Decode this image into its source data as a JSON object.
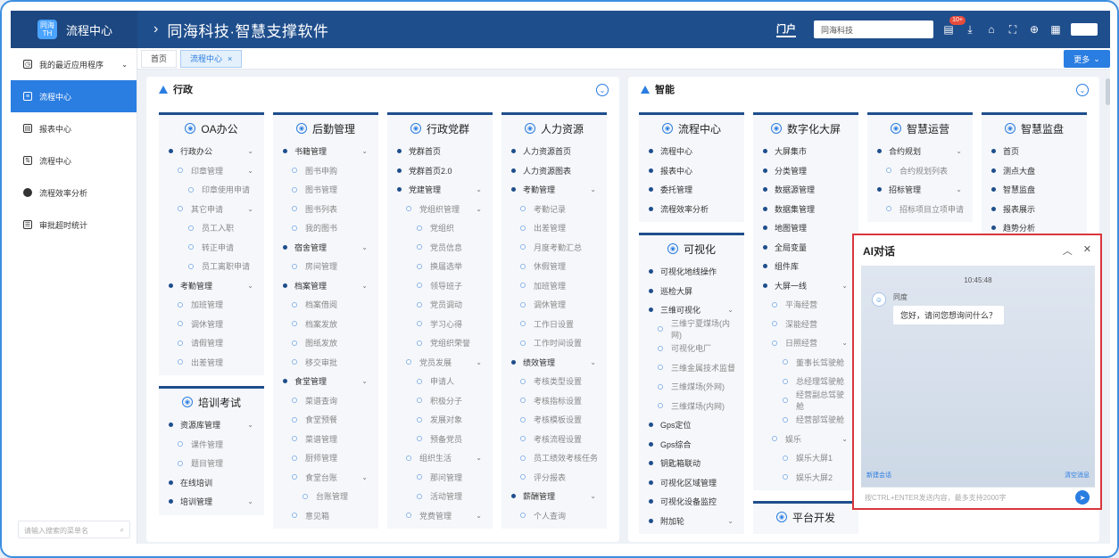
{
  "header": {
    "app_title": "流程中心",
    "logo_text": "同海 TH",
    "system_title": "同海科技·智慧支撑软件",
    "brand_icon": "门户",
    "search_value": "同海科技",
    "badge": "10+"
  },
  "sidebar": {
    "items": [
      {
        "label": "我的最近应用程序",
        "icon": "clock-icon"
      },
      {
        "label": "流程中心",
        "icon": "list-icon"
      },
      {
        "label": "报表中心",
        "icon": "report-icon"
      },
      {
        "label": "流程中心",
        "icon": "flow-icon"
      },
      {
        "label": "流程效率分析",
        "icon": "pie-icon"
      },
      {
        "label": "审批超时统计",
        "icon": "db-icon"
      }
    ],
    "search_placeholder": "请输入搜索的菜单名"
  },
  "tabs": {
    "items": [
      "首页",
      "流程中心"
    ],
    "more": "更多"
  },
  "panels": {
    "left_title": "行政",
    "right_title": "智能"
  },
  "left_cols": [
    [
      {
        "title": "OA办公",
        "items": [
          [
            "l1",
            "行政办公",
            1
          ],
          [
            "l2",
            "印章管理",
            1
          ],
          [
            "l3",
            "印章使用申请",
            0
          ],
          [
            "l2",
            "其它申请",
            1
          ],
          [
            "l3",
            "员工入职",
            0
          ],
          [
            "l3",
            "转正申请",
            0
          ],
          [
            "l3",
            "员工离职申请",
            0
          ],
          [
            "l1",
            "考勤管理",
            1
          ],
          [
            "l2",
            "加班管理",
            0
          ],
          [
            "l2",
            "调休管理",
            0
          ],
          [
            "l2",
            "请假管理",
            0
          ],
          [
            "l2",
            "出差管理",
            0
          ]
        ]
      },
      {
        "title": "培训考试",
        "items": [
          [
            "l1",
            "资源库管理",
            1
          ],
          [
            "l2",
            "课件管理",
            0
          ],
          [
            "l2",
            "题目管理",
            0
          ],
          [
            "l1",
            "在线培训",
            0
          ],
          [
            "l1",
            "培训管理",
            1
          ]
        ]
      }
    ],
    [
      {
        "title": "后勤管理",
        "items": [
          [
            "l1",
            "书籍管理",
            1
          ],
          [
            "l2",
            "图书申购",
            0
          ],
          [
            "l2",
            "图书管理",
            0
          ],
          [
            "l2",
            "图书列表",
            0
          ],
          [
            "l2",
            "我的图书",
            0
          ],
          [
            "l1",
            "宿舍管理",
            1
          ],
          [
            "l2",
            "房间管理",
            0
          ],
          [
            "l1",
            "档案管理",
            1
          ],
          [
            "l2",
            "档案借阅",
            0
          ],
          [
            "l2",
            "档案发放",
            0
          ],
          [
            "l2",
            "图纸发放",
            0
          ],
          [
            "l2",
            "移交审批",
            0
          ],
          [
            "l1",
            "食堂管理",
            1
          ],
          [
            "l2",
            "菜谱查询",
            0
          ],
          [
            "l2",
            "食堂预餐",
            0
          ],
          [
            "l2",
            "菜谱管理",
            0
          ],
          [
            "l2",
            "厨师管理",
            0
          ],
          [
            "l2",
            "食堂台账",
            1
          ],
          [
            "l3",
            "台账管理",
            0
          ],
          [
            "l2",
            "意见箱",
            0
          ]
        ]
      }
    ],
    [
      {
        "title": "行政党群",
        "items": [
          [
            "l1",
            "党群首页",
            0
          ],
          [
            "l1",
            "党群首页2.0",
            0
          ],
          [
            "l1",
            "党建管理",
            1
          ],
          [
            "l2",
            "党组织管理",
            1
          ],
          [
            "l3",
            "党组织",
            0
          ],
          [
            "l3",
            "党员信息",
            0
          ],
          [
            "l3",
            "换届选举",
            0
          ],
          [
            "l3",
            "领导班子",
            0
          ],
          [
            "l3",
            "党员调动",
            0
          ],
          [
            "l3",
            "学习心得",
            0
          ],
          [
            "l3",
            "党组织荣誉",
            0
          ],
          [
            "l2",
            "党员发展",
            1
          ],
          [
            "l3",
            "申请人",
            0
          ],
          [
            "l3",
            "积极分子",
            0
          ],
          [
            "l3",
            "发展对象",
            0
          ],
          [
            "l3",
            "预备党员",
            0
          ],
          [
            "l2",
            "组织生活",
            1
          ],
          [
            "l3",
            "那问管理",
            0
          ],
          [
            "l3",
            "活动管理",
            0
          ],
          [
            "l2",
            "党费管理",
            1
          ]
        ]
      }
    ],
    [
      {
        "title": "人力资源",
        "items": [
          [
            "l1",
            "人力资源首页",
            0
          ],
          [
            "l1",
            "人力资源图表",
            0
          ],
          [
            "l1",
            "考勤管理",
            1
          ],
          [
            "l2",
            "考勤记录",
            0
          ],
          [
            "l2",
            "出差管理",
            0
          ],
          [
            "l2",
            "月度考勤汇总",
            0
          ],
          [
            "l2",
            "休假管理",
            0
          ],
          [
            "l2",
            "加班管理",
            0
          ],
          [
            "l2",
            "调休管理",
            0
          ],
          [
            "l2",
            "工作日设置",
            0
          ],
          [
            "l2",
            "工作时间设置",
            0
          ],
          [
            "l1",
            "绩效管理",
            1
          ],
          [
            "l2",
            "考核类型设置",
            0
          ],
          [
            "l2",
            "考核指标设置",
            0
          ],
          [
            "l2",
            "考核模板设置",
            0
          ],
          [
            "l2",
            "考核流程设置",
            0
          ],
          [
            "l2",
            "员工绩效考核任务",
            0
          ],
          [
            "l2",
            "评分报表",
            0
          ],
          [
            "l1",
            "薪酬管理",
            1
          ],
          [
            "l2",
            "个人查询",
            0
          ]
        ]
      }
    ]
  ],
  "right_cols": [
    [
      {
        "title": "流程中心",
        "items": [
          [
            "l1",
            "流程中心",
            0
          ],
          [
            "l1",
            "报表中心",
            0
          ],
          [
            "l1",
            "委托管理",
            0
          ],
          [
            "l1",
            "流程效率分析",
            0
          ]
        ]
      },
      {
        "title": "可视化",
        "items": [
          [
            "l1",
            "可视化地线操作",
            0
          ],
          [
            "l1",
            "巡检大屏",
            0
          ],
          [
            "l1",
            "三维可视化",
            1
          ],
          [
            "l2",
            "三维宁夏煤场(内网)",
            0
          ],
          [
            "l2",
            "可视化电厂",
            0
          ],
          [
            "l2",
            "三维金属技术监督",
            0
          ],
          [
            "l2",
            "三维煤场(外网)",
            0
          ],
          [
            "l2",
            "三维煤场(内网)",
            0
          ],
          [
            "l1",
            "Gps定位",
            0
          ],
          [
            "l1",
            "Gps综合",
            0
          ],
          [
            "l1",
            "钥匙箱联动",
            0
          ],
          [
            "l1",
            "可视化区域管理",
            0
          ],
          [
            "l1",
            "可视化设备监控",
            0
          ],
          [
            "l1",
            "附加轮",
            1
          ]
        ]
      }
    ],
    [
      {
        "title": "数字化大屏",
        "items": [
          [
            "l1",
            "大屏集市",
            0
          ],
          [
            "l1",
            "分类管理",
            0
          ],
          [
            "l1",
            "数据源管理",
            0
          ],
          [
            "l1",
            "数据集管理",
            0
          ],
          [
            "l1",
            "地图管理",
            0
          ],
          [
            "l1",
            "全局变量",
            0
          ],
          [
            "l1",
            "组件库",
            0
          ],
          [
            "l1",
            "大屏一线",
            1
          ],
          [
            "l2",
            "平海经营",
            0
          ],
          [
            "l2",
            "深能经营",
            0
          ],
          [
            "l2",
            "日照经营",
            1
          ],
          [
            "l3",
            "董事长驾驶舱",
            0
          ],
          [
            "l3",
            "总经理驾驶舱",
            0
          ],
          [
            "l3",
            "经营副总驾驶舱",
            0
          ],
          [
            "l3",
            "经营部驾驶舱",
            0
          ],
          [
            "l2",
            "娱乐",
            1
          ],
          [
            "l3",
            "娱乐大屏1",
            0
          ],
          [
            "l3",
            "娱乐大屏2",
            0
          ]
        ]
      },
      {
        "title": "平台开发",
        "items": []
      }
    ],
    [
      {
        "title": "智慧运营",
        "items": [
          [
            "l1",
            "合约规划",
            1
          ],
          [
            "l2",
            "合约规划列表",
            0
          ],
          [
            "l1",
            "招标管理",
            1
          ],
          [
            "l2",
            "招标项目立项申请",
            0
          ]
        ]
      }
    ],
    [
      {
        "title": "智慧监盘",
        "items": [
          [
            "l1",
            "首页",
            0
          ],
          [
            "l1",
            "测点大盘",
            0
          ],
          [
            "l1",
            "智慧监盘",
            0
          ],
          [
            "l1",
            "报表展示",
            0
          ],
          [
            "l1",
            "趋势分析",
            0
          ]
        ]
      }
    ]
  ],
  "ai": {
    "title": "AI对话",
    "time": "10:45:48",
    "bot_name": "同度",
    "greeting": "您好，请问您想询问什么？",
    "new_session": "新建会话",
    "clear": "清空消息",
    "input_placeholder": "按CTRL+ENTER发送内容，最多支持2000字"
  }
}
